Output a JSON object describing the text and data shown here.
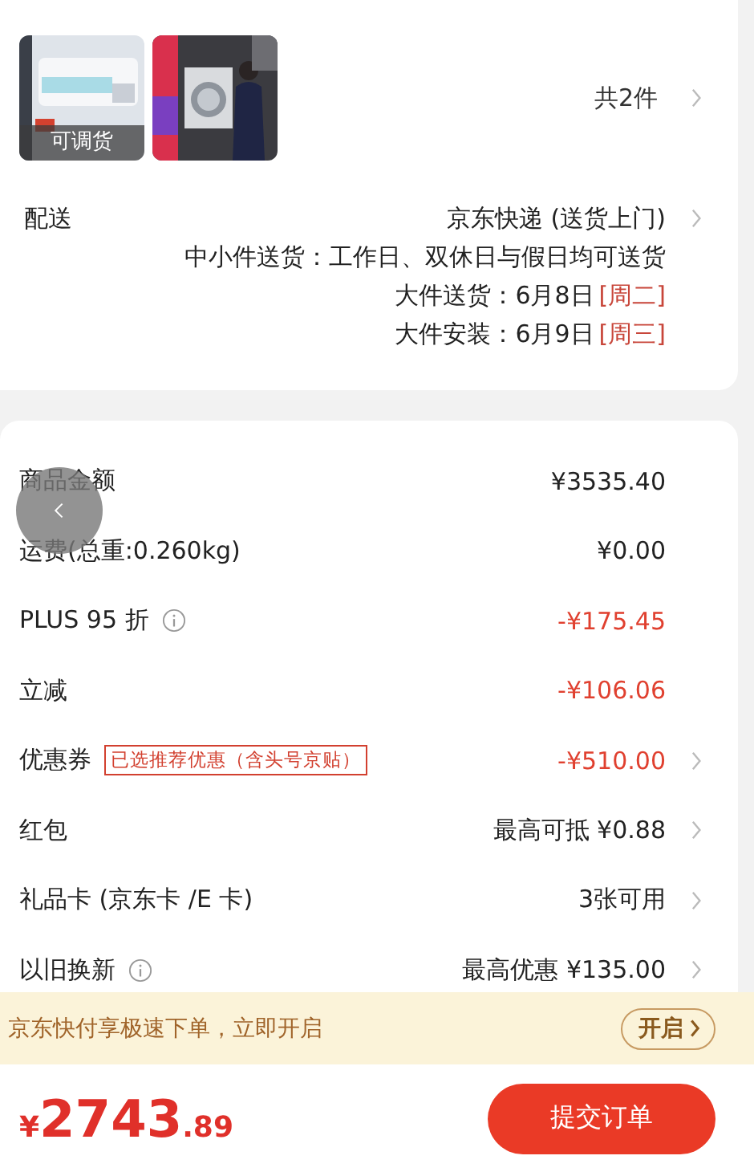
{
  "products": {
    "items": [
      {
        "kind": "picture",
        "badge": "可调货"
      },
      {
        "kind": "picture"
      }
    ],
    "count": "共2件"
  },
  "delivery": {
    "label": "配送",
    "method": "京东快递 (送货上门)",
    "lines": [
      {
        "kind": "note",
        "text": "中小件送货：工作日、双休日与假日均可送货"
      },
      {
        "kind": "date",
        "label": "大件送货：",
        "date": "6月8日",
        "weekday": "[周二]"
      },
      {
        "kind": "date",
        "label": "大件安装：",
        "date": "6月9日",
        "weekday": "[周三]"
      }
    ]
  },
  "fees": [
    {
      "label": "商品金额",
      "info": false,
      "value": "¥3535.40",
      "discount": false,
      "arrow": false
    },
    {
      "label": "运费(总重:0.260kg)",
      "info": false,
      "value": "¥0.00",
      "discount": false,
      "arrow": false
    },
    {
      "label": "PLUS 95 折",
      "info": true,
      "value": "-¥175.45",
      "discount": true,
      "arrow": false
    },
    {
      "label": "立减",
      "info": false,
      "value": "-¥106.06",
      "discount": true,
      "arrow": false
    },
    {
      "label": "优惠券",
      "info": false,
      "tag": "已选推荐优惠（含头号京贴）",
      "value": "-¥510.00",
      "discount": true,
      "arrow": true
    },
    {
      "label": "红包",
      "info": false,
      "value": "最高可抵 ¥0.88",
      "discount": false,
      "arrow": true
    },
    {
      "label": "礼品卡 (京东卡 /E 卡)",
      "info": false,
      "value": "3张可用",
      "discount": false,
      "arrow": true
    },
    {
      "label": "以旧换新",
      "info": true,
      "value": "最高优惠 ¥135.00",
      "discount": false,
      "arrow": true
    }
  ],
  "banner": {
    "text": "京东快付享极速下单，立即开启",
    "button": "开启"
  },
  "footer": {
    "currency": "¥",
    "integer": "2743",
    "decimal": ".89",
    "submit": "提交订单"
  }
}
